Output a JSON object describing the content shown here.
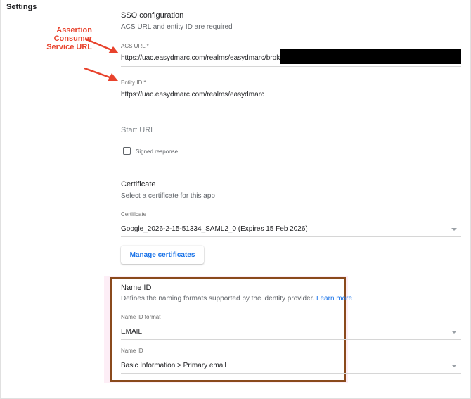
{
  "settings_title": "Settings",
  "annotation": {
    "line1": "Assertion Consumer",
    "line2": "Service URL",
    "color": "#e8422c"
  },
  "sso": {
    "heading": "SSO configuration",
    "subtitle": "ACS URL and entity ID are required",
    "acs_label": "ACS URL *",
    "acs_value": "https://uac.easydmarc.com/realms/easydmarc/broker",
    "entity_label": "Entity ID *",
    "entity_value": "https://uac.easydmarc.com/realms/easydmarc",
    "start_url_placeholder": "Start URL",
    "signed_response_label": "Signed response"
  },
  "certificate": {
    "heading": "Certificate",
    "subtitle": "Select a certificate for this app",
    "field_label": "Certificate",
    "selected_value": "Google_2026-2-15-51334_SAML2_0 (Expires 15 Feb 2026)",
    "manage_button": "Manage certificates"
  },
  "name_id": {
    "heading": "Name ID",
    "description": "Defines the naming formats supported by the identity provider.",
    "learn_more": "Learn more",
    "format_label": "Name ID format",
    "format_value": "EMAIL",
    "name_id_label": "Name ID",
    "name_id_value": "Basic Information > Primary email"
  }
}
